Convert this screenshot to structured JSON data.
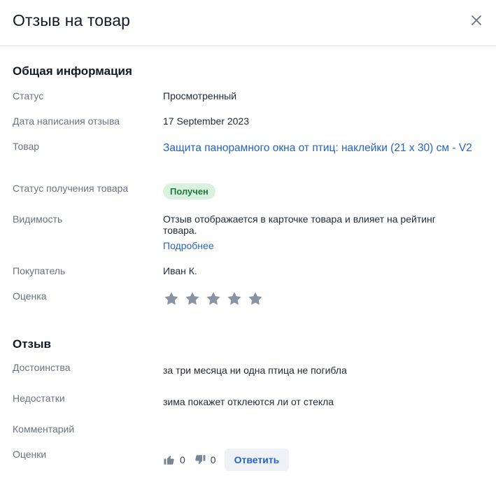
{
  "header": {
    "title": "Отзыв на товар",
    "close_icon": "close-icon"
  },
  "general": {
    "title": "Общая информация",
    "status_label": "Статус",
    "status_value": "Просмотренный",
    "date_label": "Дата написания отзыва",
    "date_value": "17 September 2023",
    "product_label": "Товар",
    "product_value": "Защита панорамного окна от птиц: наклейки (21 х 30) см - V2",
    "receipt_label": "Статус получения товара",
    "receipt_value": "Получен",
    "visibility_label": "Видимость",
    "visibility_value": "Отзыв отображается в карточке товара и влияет на рейтинг товара.",
    "visibility_link": "Подробнее",
    "buyer_label": "Покупатель",
    "buyer_value": "Иван К.",
    "score_label": "Оценка",
    "score_stars_filled": 0,
    "score_stars_total": 5,
    "star_color": "#8a93a3"
  },
  "review": {
    "title": "Отзыв",
    "pros_label": "Достоинства",
    "pros_value": "за три месяца ни одна птица не погибла",
    "cons_label": "Недостатки",
    "cons_value": "зима покажет отклеются ли от стекла",
    "comment_label": "Комментарий",
    "ratings_label": "Оценки",
    "likes": "0",
    "dislikes": "0",
    "reply_button": "Ответить"
  },
  "colors": {
    "accent": "#2563c9",
    "badge_bg": "#d9f2e0",
    "badge_text": "#1f7a3d"
  }
}
